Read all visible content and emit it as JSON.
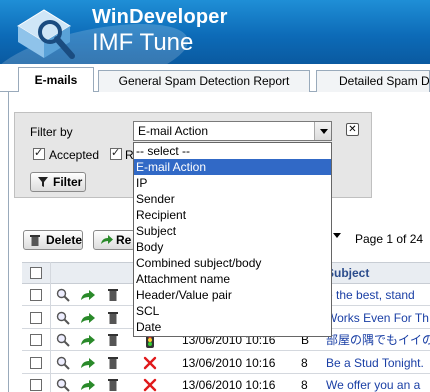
{
  "header": {
    "brand_top": "WinDeveloper",
    "brand_bottom": "IMF Tune"
  },
  "tabs": [
    {
      "label": "E-mails",
      "active": true
    },
    {
      "label": "General Spam Detection Report",
      "active": false
    },
    {
      "label": "Detailed Spam Detection Report",
      "active": false
    }
  ],
  "filter": {
    "label": "Filter by",
    "selected": "E-mail Action",
    "accepted_label": "Accepted",
    "accepted_checked": true,
    "second_checked": true,
    "second_label_partial": "R",
    "button_label": "Filter",
    "options": [
      "-- select --",
      "E-mail Action",
      "IP",
      "Sender",
      "Recipient",
      "Subject",
      "Body",
      "Combined subject/body",
      "Attachment name",
      "Header/Value pair",
      "SCL",
      "Date"
    ],
    "highlighted_option": "E-mail Action"
  },
  "toolbar": {
    "delete_label": "Delete",
    "second_label_partial": "Re",
    "pager_text": "Page 1 of 24"
  },
  "table": {
    "subject_header": "Subject",
    "rows": [
      {
        "status": "",
        "date": "",
        "scl": "",
        "subject": "e the best, stand"
      },
      {
        "status": "",
        "date": "",
        "scl": "",
        "subject": "Works Even For Th"
      },
      {
        "status": "traffic-light-icon",
        "date": "13/06/2010 10:16",
        "scl": "B",
        "subject": "部屋の隅でもイイの"
      },
      {
        "status": "x-icon",
        "date": "13/06/2010 10:16",
        "scl": "8",
        "subject": "Be a Stud Tonight."
      },
      {
        "status": "x-icon",
        "date": "13/06/2010 10:16",
        "scl": "8",
        "subject": "We offer you an a"
      }
    ]
  },
  "colors": {
    "header_blue": "#0d6bb8",
    "selection_blue": "#3169c6",
    "subject_link": "#1a3fa5",
    "reject_red": "#e0191b"
  }
}
